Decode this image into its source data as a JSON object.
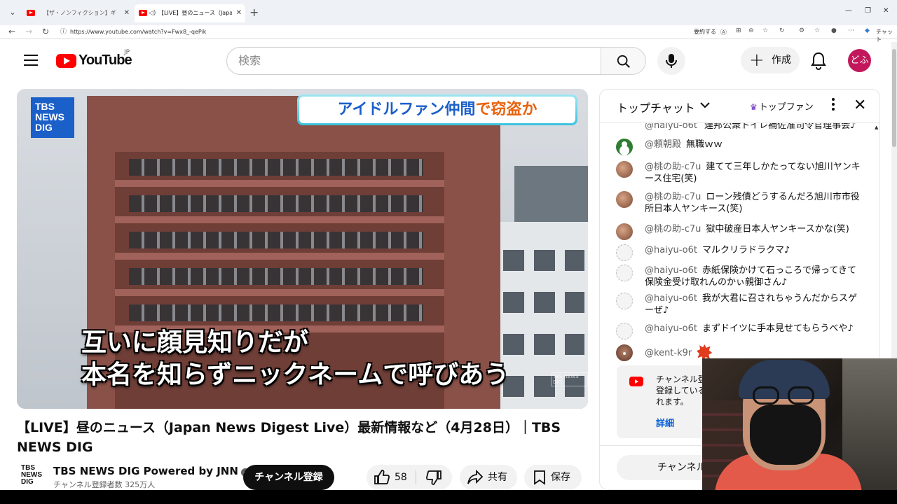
{
  "browser": {
    "tabs": [
      {
        "title": "【ザ・ノンフィクション】ギャンブル依存と闘",
        "active": false
      },
      {
        "title": "【LIVE】昼のニュース（Japan News Digest Live）",
        "active": true
      }
    ],
    "url": "https://www.youtube.com/watch?v=Fwx8_-qePik",
    "toolbar_text": "要約する",
    "chat_label": "チャット"
  },
  "header": {
    "logo_text": "YouTube",
    "region": "JP",
    "search_placeholder": "検索",
    "create_label": "作成",
    "avatar_text": "どふ"
  },
  "video": {
    "logo_line1": "TBS",
    "logo_line2": "NEWS",
    "logo_line3": "DIG",
    "headline_part1": "アイドルファン仲間",
    "headline_part2": "で窃盗か",
    "subtitle_line1": "互いに顔見知りだが",
    "subtitle_line2": "本名を知らずニックネームで呼びあう",
    "watermark": "TBS NEWS DIG"
  },
  "title": "【LIVE】昼のニュース（Japan News Digest Live）最新情報など（4月28日）｜TBS NEWS DIG",
  "channel": {
    "logo_line1": "TBS",
    "logo_line2": "NEWS",
    "logo_line3": "DIG",
    "name": "TBS NEWS DIG Powered by JNN",
    "subscribers": "チャンネル登録者数 325万人",
    "subscribe_label": "チャンネル登録",
    "likes": "58",
    "share_label": "共有",
    "save_label": "保存"
  },
  "chat": {
    "title": "トップチャット",
    "top_fan_label": "トップファン",
    "clipped_message": {
      "author": "@haiyu-o6t",
      "text": "連邦公衆トイレ補佐准司令官理事会♪"
    },
    "messages": [
      {
        "author": "@頼朝殿",
        "text": "無職ｗｗ"
      },
      {
        "author": "@桃の助-c7u",
        "text": "建てて三年しかたってない旭川ヤンキース住宅(笑)"
      },
      {
        "author": "@桃の助-c7u",
        "text": "ローン残債どうするんだろ旭川市市役所日本人ヤンキース(笑)"
      },
      {
        "author": "@桃の助-c7u",
        "text": "獄中破産日本人ヤンキースかな(笑)"
      },
      {
        "author": "@haiyu-o6t",
        "text": "マルクリラドラクマ♪"
      },
      {
        "author": "@haiyu-o6t",
        "text": "赤紙保険かけて石っころで帰ってきて保険金受け取れんのかぃ親御さん♪"
      },
      {
        "author": "@haiyu-o6t",
        "text": "我が大君に召されちゃうんだからスゲーぜ♪"
      },
      {
        "author": "@haiyu-o6t",
        "text": "まずドイツに手本見せてもらうべや♪"
      },
      {
        "author": "@kent-k9r",
        "text": ""
      }
    ],
    "system_text": "チャンネル登録している視聴者のみチャットに参加できます。",
    "system_text_visible": "チャンネル登\n登録している\nれます。",
    "details_link": "詳細",
    "join_label": "チャンネル登録"
  }
}
